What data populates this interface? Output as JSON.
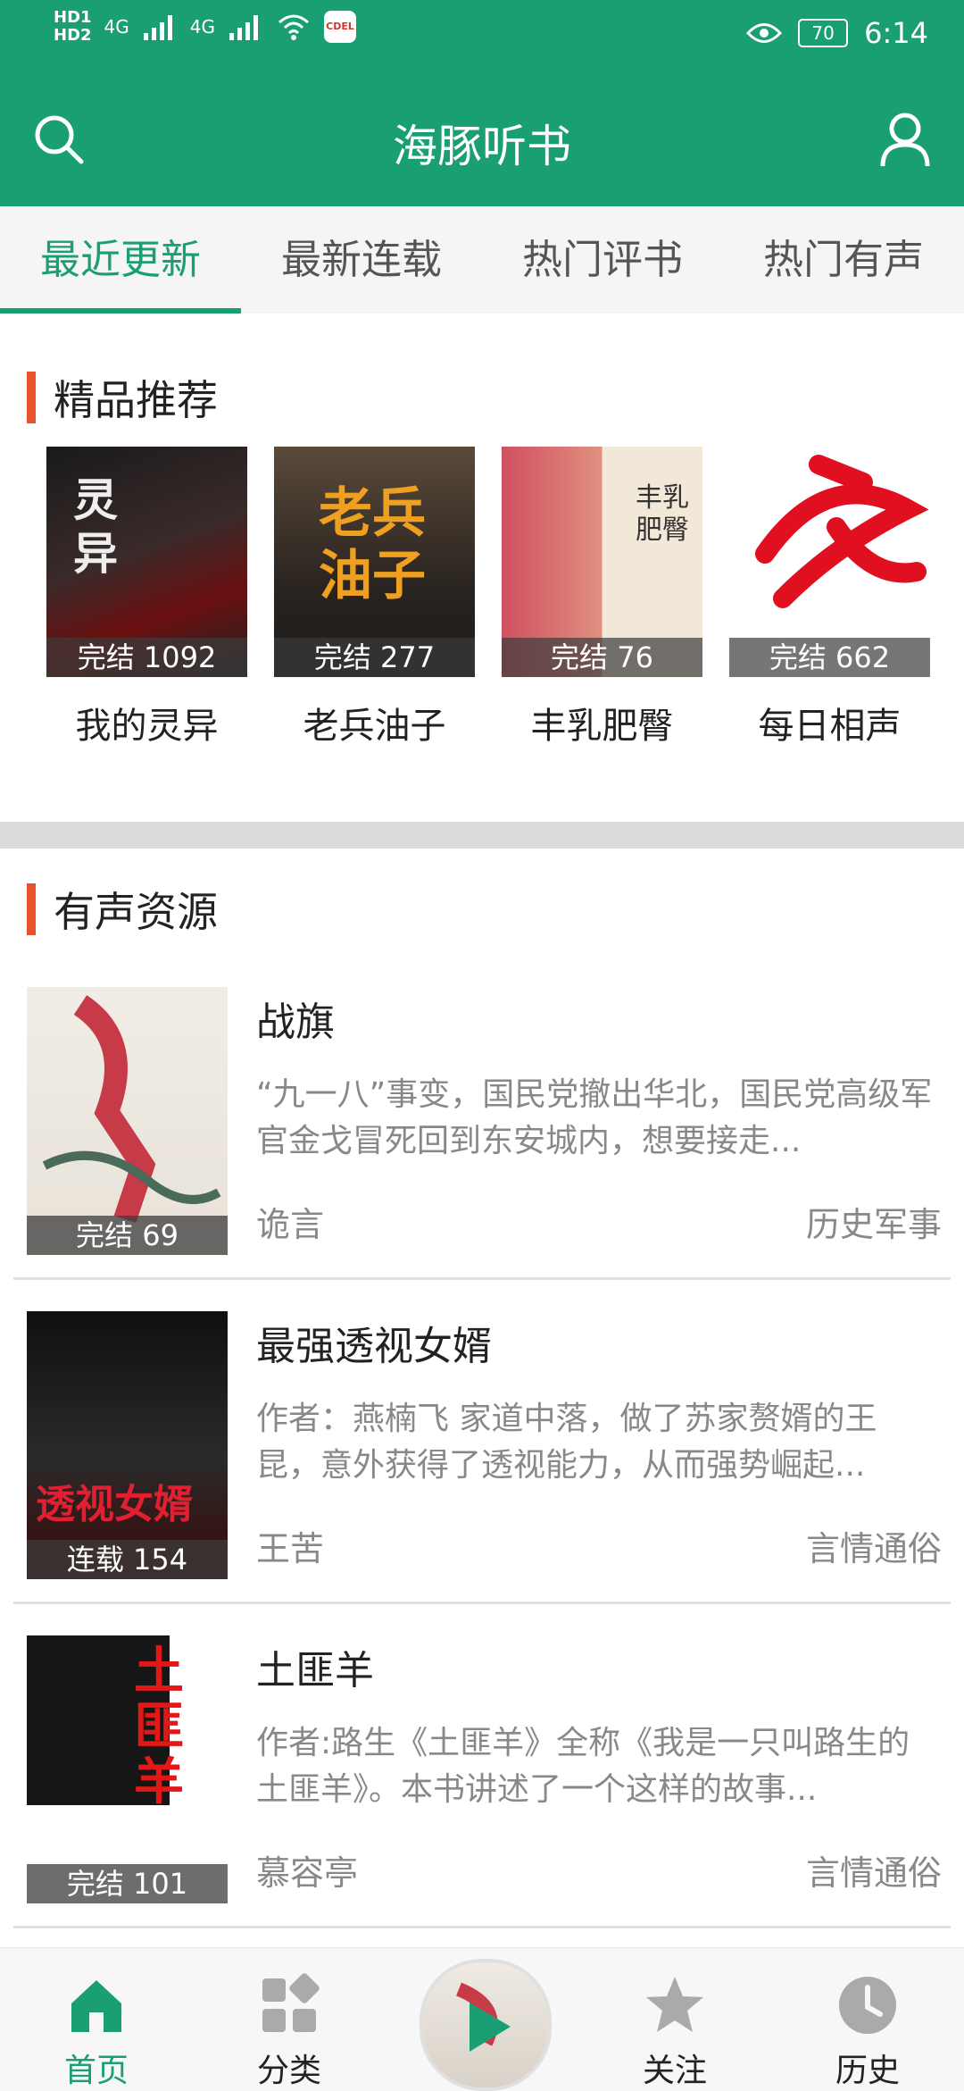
{
  "status_bar": {
    "hd1": "HD1",
    "hd2": "HD2",
    "net1": "4G",
    "net2": "4G",
    "badge": "CDEL",
    "battery": "70",
    "time": "6:14"
  },
  "app": {
    "title": "海豚听书"
  },
  "tabs": [
    "最近更新",
    "最新连载",
    "热门评书",
    "热门有声"
  ],
  "featured": {
    "title": "精品推荐",
    "items": [
      {
        "name": "我的灵异",
        "status": "完结 1092"
      },
      {
        "name": "老兵油子",
        "status": "完结 277"
      },
      {
        "name": "丰乳肥臀",
        "status": "完结 76"
      },
      {
        "name": "每日相声",
        "status": "完结 662"
      }
    ]
  },
  "audio": {
    "title": "有声资源",
    "items": [
      {
        "name": "战旗",
        "desc": "“九一八”事变，国民党撤出华北，国民党高级军官金戈冒死回到东安城内，想要接走...",
        "author": "诡言",
        "genre": "历史军事",
        "status": "完结 69"
      },
      {
        "name": "最强透视女婿",
        "desc": "作者：燕楠飞 家道中落，做了苏家赘婿的王昆，意外获得了透视能力，从而强势崛起...",
        "author": "王苦",
        "genre": "言情通俗",
        "status": "连载 154"
      },
      {
        "name": "土匪羊",
        "desc": "作者:路生《土匪羊》全称《我是一只叫路生的土匪羊》。本书讲述了一个这样的故事...",
        "author": "慕容亭",
        "genre": "言情通俗",
        "status": "完结 101"
      }
    ]
  },
  "nav": [
    "首页",
    "分类",
    "关注",
    "历史"
  ],
  "colors": {
    "brand": "#1a9e74",
    "accent": "#e8542a"
  }
}
